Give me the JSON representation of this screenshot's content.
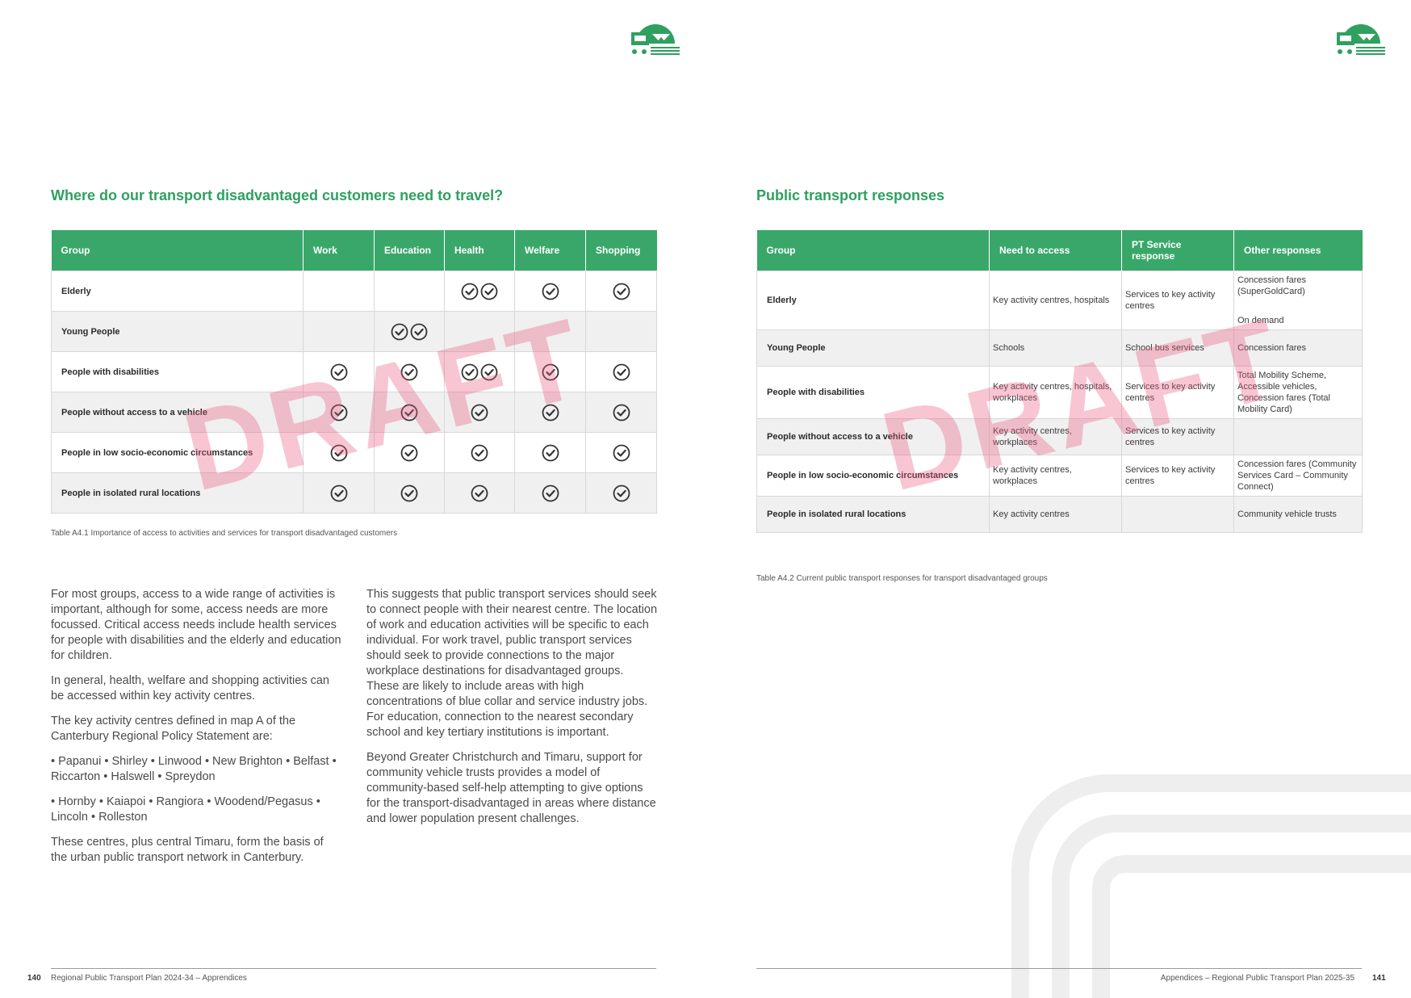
{
  "left": {
    "title": "Where do our transport disadvantaged customers need to travel?",
    "table": {
      "headers": [
        "Group",
        "Work",
        "Education",
        "Health",
        "Welfare",
        "Shopping"
      ],
      "rows": [
        {
          "group": "Elderly",
          "checks": [
            0,
            0,
            2,
            1,
            1
          ]
        },
        {
          "group": "Young People",
          "checks": [
            0,
            2,
            0,
            0,
            0
          ]
        },
        {
          "group": "People with disabilities",
          "checks": [
            1,
            1,
            2,
            1,
            1
          ]
        },
        {
          "group": "People without access to a vehicle",
          "checks": [
            1,
            1,
            1,
            1,
            1
          ]
        },
        {
          "group": "People in low socio-economic circumstances",
          "checks": [
            1,
            1,
            1,
            1,
            1
          ]
        },
        {
          "group": "People in isolated rural locations",
          "checks": [
            1,
            1,
            1,
            1,
            1
          ]
        }
      ]
    },
    "caption": "Table A4.1 Importance of access to activities and services for transport disadvantaged customers",
    "col1": [
      "For most groups, access to a wide range of activities is important, although for some, access needs are more focussed. Critical access needs include health services for people with disabilities and the elderly and education for children.",
      "In general, health, welfare and shopping activities can be accessed within key activity centres.",
      "The key activity centres defined in map A of the Canterbury Regional Policy Statement are:",
      "• Papanui • Shirley • Linwood • New Brighton • Belfast • Riccarton • Halswell • Spreydon",
      "• Hornby • Kaiapoi • Rangiora • Woodend/Pegasus • Lincoln • Rolleston",
      "These centres, plus central Timaru, form the basis of the urban public transport network in Canterbury."
    ],
    "col2": [
      "This suggests that public transport services should seek to connect people with their nearest centre. The location of work and education activities will be specific to each individual. For work travel, public transport services should seek to provide connections to the major workplace destinations for disadvantaged groups. These are likely to include areas with high concentrations of blue collar and service industry jobs. For education, connection to the nearest secondary school and key tertiary institutions is important.",
      "Beyond Greater Christchurch and Timaru, support for community vehicle trusts provides a model of community-based self-help attempting to give options for the transport-disadvantaged in areas where distance and lower population present challenges."
    ],
    "watermark": "DRAFT",
    "footer_page": "140",
    "footer_text": "Regional Public Transport Plan 2024-34 – Apprendices"
  },
  "right": {
    "title": "Public transport responses",
    "table": {
      "headers": [
        "Group",
        "Need to access",
        "PT Service response",
        "Other responses"
      ],
      "rows": [
        {
          "group": "Elderly",
          "need": "Key activity centres, hospitals",
          "pt": "Services to key activity centres",
          "other": "Concession fares (SuperGoldCard)",
          "other2": "On demand"
        },
        {
          "group": "Young People",
          "need": "Schools",
          "pt": "School bus services",
          "other": "Concession fares",
          "other2": ""
        },
        {
          "group": "People with disabilities",
          "need": "Key activity centres, hospitals, workplaces",
          "pt": "Services to key activity centres",
          "other": "Total Mobility Scheme, Accessible vehicles, Concession fares (Total Mobility Card)",
          "other2": ""
        },
        {
          "group": "People without access to a vehicle",
          "need": "Key activity centres, workplaces",
          "pt": "Services to key activity centres",
          "other": "",
          "other2": ""
        },
        {
          "group": "People in low socio-economic circumstances",
          "need": "Key activity centres, workplaces",
          "pt": "Services to key activity centres",
          "other": "Concession fares (Community Services Card – Community Connect)",
          "other2": ""
        },
        {
          "group": "People in isolated rural locations",
          "need": "Key activity centres",
          "pt": "",
          "other": "Community vehicle trusts",
          "other2": ""
        }
      ]
    },
    "caption": "Table A4.2 Current public transport responses for transport disadvantaged groups",
    "watermark": "DRAFT",
    "footer_text": "Appendices – Regional Public Transport Plan 2025-35",
    "footer_page": "141"
  },
  "colors": {
    "accent": "#3aa76a",
    "title": "#2fa060",
    "watermark": "#eb5a82"
  },
  "icons": {
    "logo": "transport-logo-icon",
    "check": "check-circle-icon"
  }
}
